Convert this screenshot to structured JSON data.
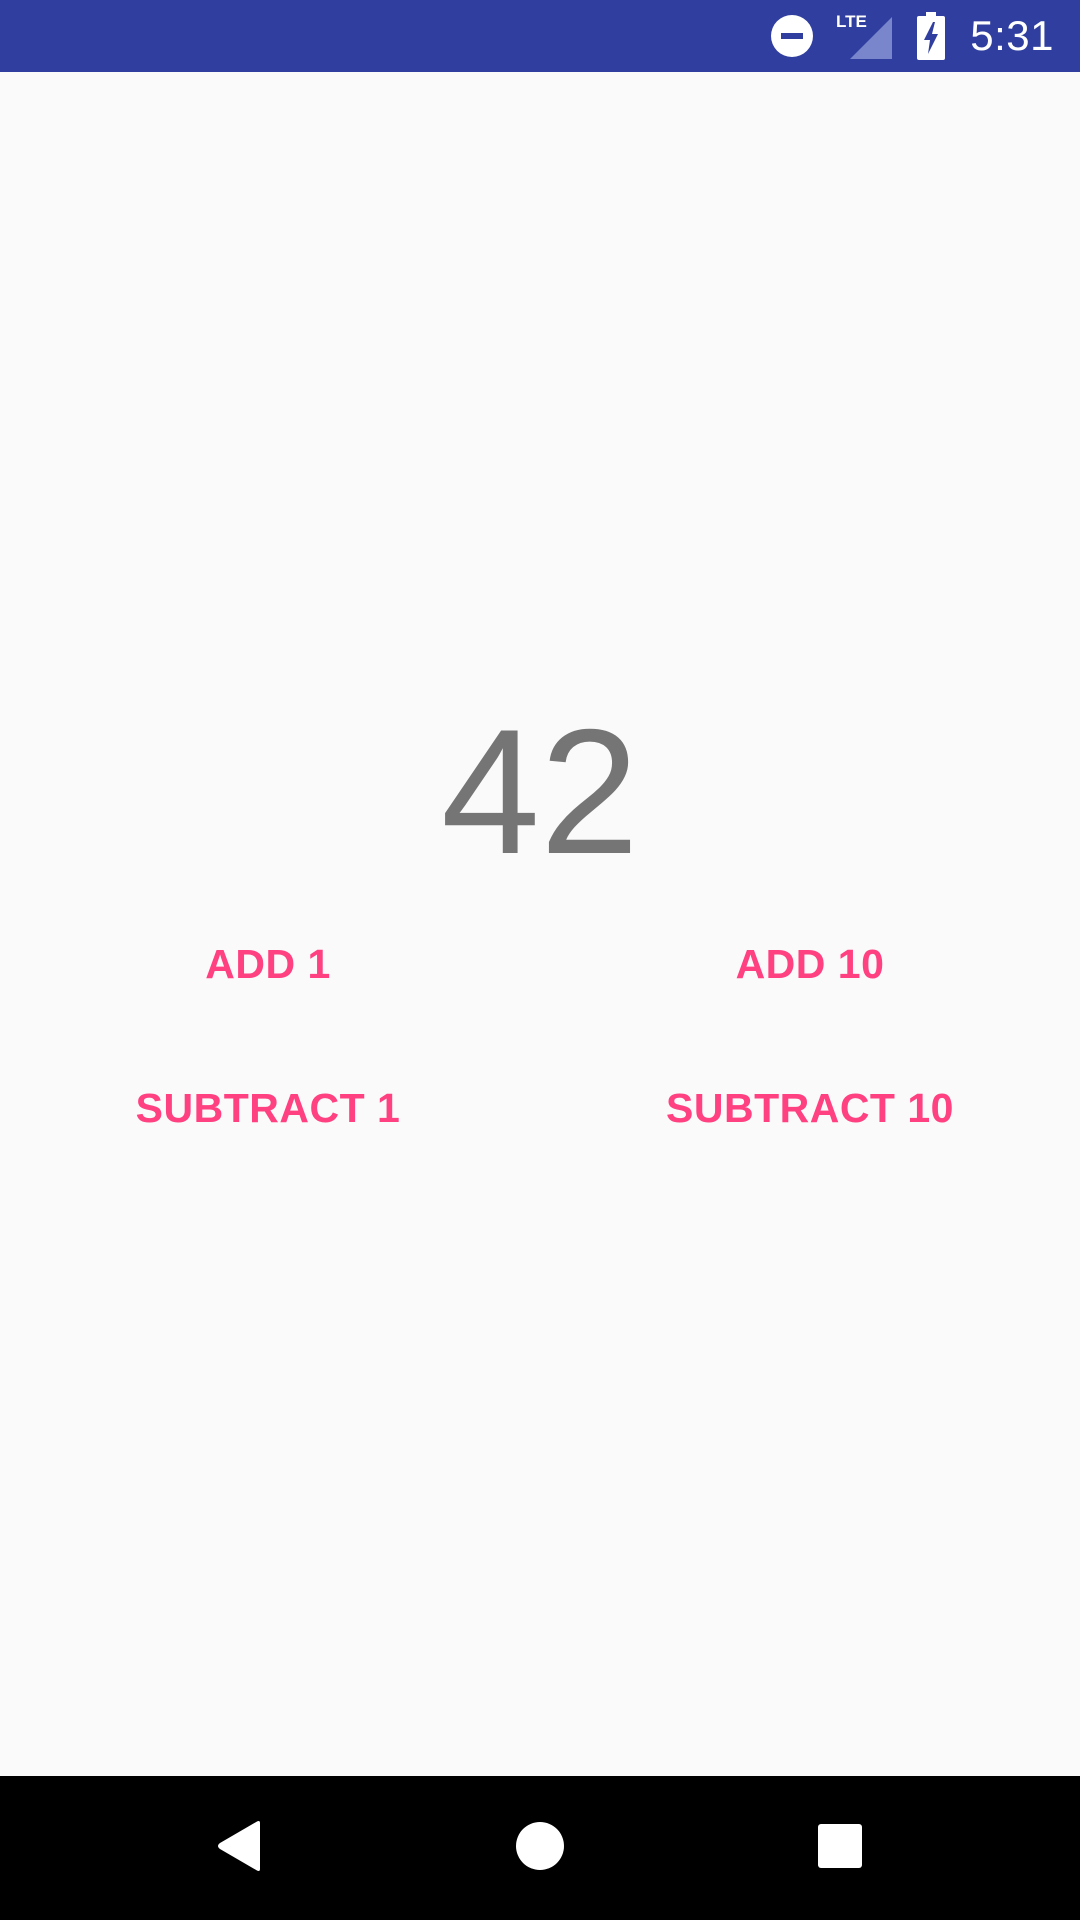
{
  "status_bar": {
    "time": "5:31",
    "network_label": "LTE",
    "background_color": "#303f9f",
    "icons": [
      "do-not-disturb-icon",
      "lte-signal-icon",
      "battery-charging-icon"
    ]
  },
  "counter": {
    "value": "42",
    "color": "#757575"
  },
  "buttons": {
    "add_1": "ADD 1",
    "add_10": "ADD 10",
    "subtract_1": "SUBTRACT 1",
    "subtract_10": "SUBTRACT 10",
    "color": "#ff4081"
  },
  "nav_bar": {
    "icons": [
      "back-icon",
      "home-icon",
      "recents-icon"
    ]
  }
}
